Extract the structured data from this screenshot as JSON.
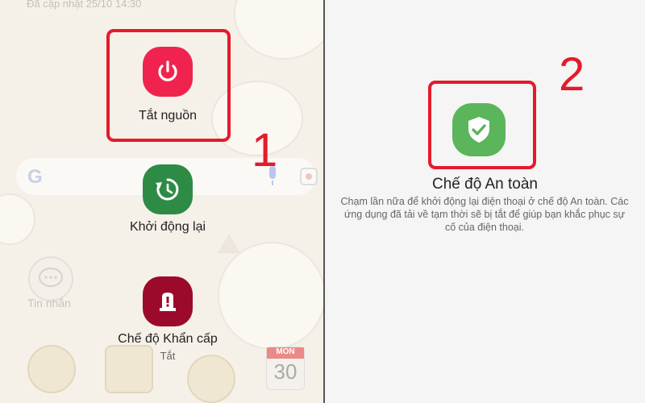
{
  "status": {
    "text": "Đã cập nhật 25/10 14:30"
  },
  "search": {
    "logo": "G"
  },
  "background_app": {
    "label": "Tin nhắn"
  },
  "power_menu": {
    "power_off": {
      "label": "Tắt nguồn",
      "icon": "power-icon",
      "color": "#f0234f"
    },
    "restart": {
      "label": "Khởi động lại",
      "icon": "restart-icon",
      "color": "#2e8b45"
    },
    "emergency": {
      "label": "Chế độ Khẩn cấp",
      "sublabel": "Tắt",
      "icon": "emergency-icon",
      "color": "#9b0a2b"
    }
  },
  "safe_mode": {
    "title": "Chế độ An toàn",
    "description": "Chạm lần nữa để khởi động lại điện thoại ở chế độ An toàn. Các ứng dụng đã tải về tạm thời sẽ bị tắt để giúp bạn khắc phục sự cố của điện thoại.",
    "icon": "shield-check-icon",
    "color": "#5bb55b"
  },
  "dock": {
    "calendar_month": "MON",
    "calendar_day": "30"
  },
  "annotations": {
    "step1": "1",
    "step2": "2",
    "highlight_color": "#e51a2c"
  }
}
